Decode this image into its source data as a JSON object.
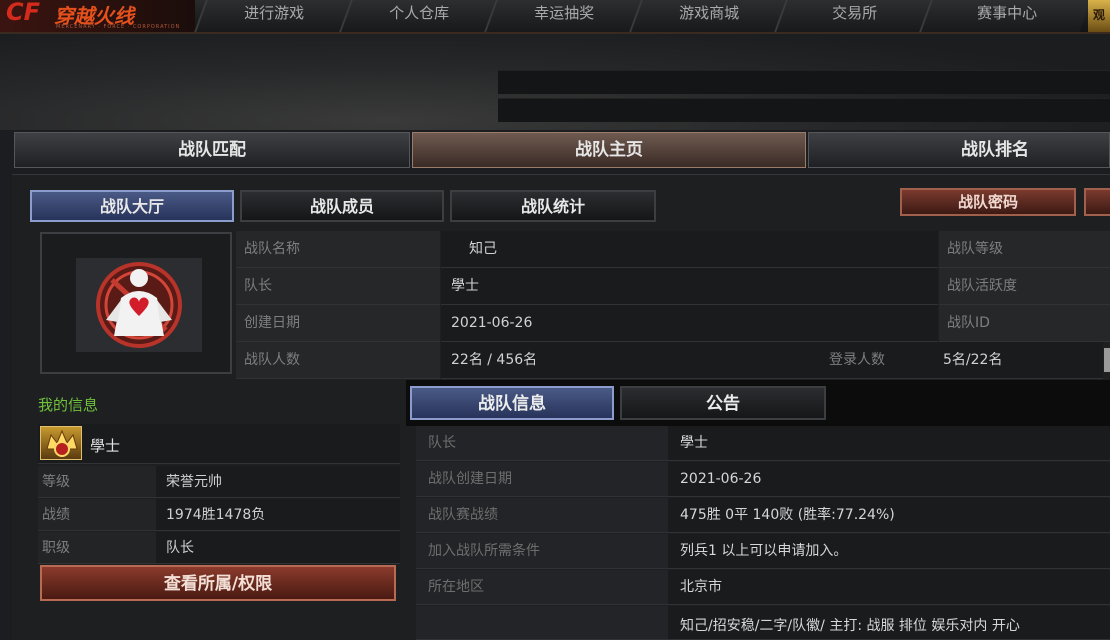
{
  "app": {
    "logo_text": "穿越火线",
    "logo_sub": "MERCENARY · FORCE · CORPORATION"
  },
  "nav": {
    "items": [
      "进行游戏",
      "个人仓库",
      "幸运抽奖",
      "游戏商城",
      "交易所",
      "赛事中心"
    ],
    "corner_badge": "观"
  },
  "primary_tabs": [
    "战队匹配",
    "战队主页",
    "战队排名"
  ],
  "primary_tab_active": "战队主页",
  "sub_tabs": [
    "战队大厅",
    "战队成员",
    "战队统计"
  ],
  "sub_tab_active": "战队大厅",
  "buttons": {
    "team_password": "战队密码",
    "view_permissions": "查看所属/权限"
  },
  "team_info": {
    "name_label": "战队名称",
    "name": "知己",
    "leader_label": "队长",
    "leader": "學士",
    "created_label": "创建日期",
    "created": "2021-06-26",
    "members_label": "战队人数",
    "members": "22名 / 456名",
    "login_label": "登录人数",
    "login": "5名/22名",
    "level_label": "战队等级",
    "activity_label": "战队活跃度",
    "id_label": "战队ID"
  },
  "my_info": {
    "title": "我的信息",
    "player_name": "學士",
    "rows": [
      {
        "label": "等级",
        "value": "荣誉元帅"
      },
      {
        "label": "战绩",
        "value": "1974胜1478负"
      },
      {
        "label": "职级",
        "value": "队长"
      }
    ]
  },
  "lower_tabs": [
    "战队信息",
    "公告"
  ],
  "lower_tab_active": "战队信息",
  "team_details": [
    {
      "label": "队长",
      "value": "學士"
    },
    {
      "label": "战队创建日期",
      "value": "2021-06-26"
    },
    {
      "label": "战队赛战绩",
      "value": "475胜 0平 140败 (胜率:77.24%)"
    },
    {
      "label": "加入战队所需条件",
      "value": "列兵1 以上可以申请加入。"
    },
    {
      "label": "所在地区",
      "value": "北京市"
    },
    {
      "label": "",
      "value": "知己/招安稳/二字/队徽/ 主打: 战服 排位 娱乐对内 开心"
    }
  ],
  "colors": {
    "active_tab_blue": "#3a4a7a",
    "primary_active": "#5a4538",
    "accent_red": "#8a3b2c",
    "my_info_green": "#6fc13c"
  }
}
